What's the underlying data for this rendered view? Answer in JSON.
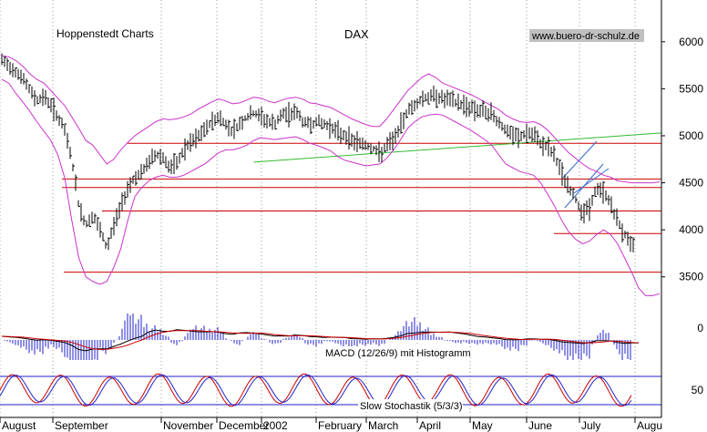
{
  "chart_data": {
    "type": "line",
    "title": "DAX",
    "source": "Hoppenstedt Charts",
    "website": "www.buero-dr-schulz.de",
    "x_labels": [
      "August",
      "September",
      "November",
      "December",
      "2002",
      "February",
      "March",
      "April",
      "May",
      "June",
      "July",
      "Augu"
    ],
    "price_axis": {
      "ticks": [
        3500,
        4000,
        4500,
        5000,
        5500,
        6000
      ],
      "ylim": [
        3100,
        6250
      ]
    },
    "macd": {
      "label": "MACD (12/26/9) mit Histogramm",
      "ticks": [
        0
      ]
    },
    "stochastic": {
      "label": "Slow Stochastik (5/3/3)",
      "ticks": [
        50
      ]
    },
    "series": [
      {
        "values": [
          5800,
          5740,
          5690,
          5610,
          5480,
          5380,
          5420,
          5330,
          5200,
          5050,
          4750,
          4250,
          4050,
          4150,
          4000,
          3800,
          4050,
          4250,
          4450,
          4560,
          4600,
          4720,
          4800,
          4780,
          4650,
          4700,
          4850,
          4920,
          4980,
          5060,
          5150,
          5200,
          5120,
          5050,
          5130,
          5200,
          5240,
          5200,
          5150,
          5120,
          5220,
          5230,
          5260,
          5150,
          5120,
          5150,
          5120,
          5100,
          5030,
          5000,
          4950,
          4930,
          4900,
          4870,
          4800,
          4890,
          4960,
          5100,
          5280,
          5320,
          5400,
          5410,
          5430,
          5390,
          5380,
          5350,
          5330,
          5300,
          5270,
          5250,
          5230,
          5150,
          5050,
          5000,
          4980,
          5030,
          5000,
          4920,
          4880,
          4780,
          4600,
          4450,
          4320,
          4180,
          4240,
          4440,
          4400,
          4280,
          4080,
          3950,
          3850,
          3720,
          3620,
          3800,
          3870
        ]
      },
      {
        "name": "upper band",
        "values": [
          5850,
          5840,
          5800,
          5740,
          5660,
          5600,
          5560,
          5480,
          5400,
          5320,
          5200,
          5080,
          4950,
          4900,
          4800,
          4700,
          4750,
          4850,
          4930,
          5000,
          5050,
          5100,
          5150,
          5180,
          5170,
          5180,
          5200,
          5230,
          5280,
          5320,
          5360,
          5390,
          5370,
          5340,
          5350,
          5380,
          5410,
          5400,
          5370,
          5350,
          5380,
          5400,
          5410,
          5390,
          5350,
          5340,
          5320,
          5300,
          5260,
          5220,
          5180,
          5150,
          5120,
          5100,
          5100,
          5180,
          5280,
          5380,
          5480,
          5550,
          5620,
          5660,
          5620,
          5560,
          5530,
          5500,
          5470,
          5440,
          5400,
          5360,
          5320,
          5280,
          5220,
          5180,
          5150,
          5140,
          5150,
          5120,
          5060,
          4980,
          4900,
          4820,
          4760,
          4700,
          4650,
          4620,
          4580,
          4560,
          4520,
          4510,
          4500,
          4500,
          4500,
          4500,
          4510
        ]
      },
      {
        "name": "lower band",
        "values": [
          5600,
          5560,
          5450,
          5360,
          5260,
          5150,
          5050,
          4950,
          4800,
          4550,
          4100,
          3700,
          3500,
          3450,
          3420,
          3450,
          3600,
          3800,
          4100,
          4350,
          4450,
          4520,
          4560,
          4580,
          4560,
          4560,
          4580,
          4620,
          4660,
          4700,
          4760,
          4820,
          4850,
          4850,
          4870,
          4900,
          4950,
          4980,
          4970,
          4960,
          4970,
          4980,
          4990,
          4960,
          4920,
          4900,
          4870,
          4840,
          4780,
          4740,
          4720,
          4700,
          4680,
          4690,
          4700,
          4760,
          4850,
          4960,
          5080,
          5150,
          5200,
          5220,
          5230,
          5220,
          5180,
          5140,
          5100,
          5060,
          5010,
          4960,
          4900,
          4800,
          4700,
          4660,
          4620,
          4600,
          4580,
          4500,
          4380,
          4250,
          4100,
          3980,
          3900,
          3850,
          3880,
          3950,
          4000,
          3950,
          3850,
          3700,
          3550,
          3380,
          3300,
          3300,
          3320
        ]
      }
    ],
    "support_resistance": [
      4920,
      4540,
      4450,
      4200,
      3960,
      3550
    ],
    "trend_line": {
      "from": [
        36,
        4720
      ],
      "to": [
        94,
        5030
      ]
    }
  }
}
